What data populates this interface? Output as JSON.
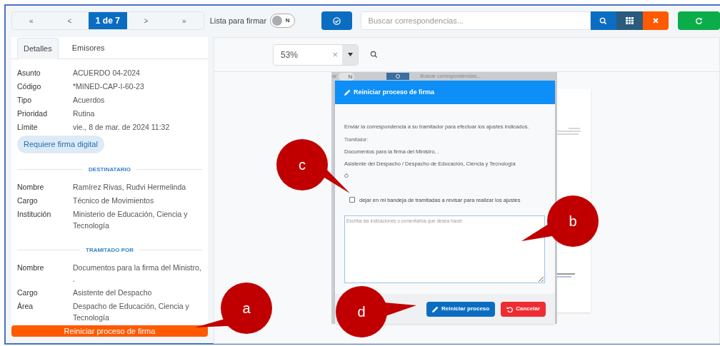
{
  "pager": {
    "items": [
      {
        "label": "«",
        "selected": false
      },
      {
        "label": "<",
        "selected": false
      },
      {
        "label": "1 de 7",
        "selected": true
      },
      {
        "label": ">",
        "selected": false
      },
      {
        "label": "»",
        "selected": false
      }
    ]
  },
  "sign_list_toggle": {
    "label": "Lista para firmar",
    "on": false,
    "state_text": "N"
  },
  "search": {
    "placeholder": "Buscar correspondencias..."
  },
  "details_panel": {
    "tabs": [
      {
        "label": "Detalles",
        "selected": true
      },
      {
        "label": "Emisores",
        "selected": false
      }
    ],
    "fields": [
      {
        "label": "Asunto",
        "value": "ACUERDO 04-2024"
      },
      {
        "label": "Código",
        "value": "*MINED-CAP-I-60-23"
      },
      {
        "label": "Tipo",
        "value": "Acuerdos"
      },
      {
        "label": "Prioridad",
        "value": "Rutina"
      },
      {
        "label": "Límite",
        "value": "vie., 8 de mar. de 2024 11:32"
      }
    ],
    "badge": "Requiere firma digital",
    "sections": [
      {
        "title": "DESTINATARIO",
        "fields": [
          {
            "label": "Nombre",
            "value": "Ramírez Rivas, Rudvi Hermelinda"
          },
          {
            "label": "Cargo",
            "value": "Técnico de Movimientos"
          },
          {
            "label": "Institución",
            "value": "Ministerio de Educación, Ciencia y Tecnología"
          }
        ]
      },
      {
        "title": "TRAMITADO POR",
        "fields": [
          {
            "label": "Nombre",
            "value": "Documentos para la firma del Ministro, ."
          },
          {
            "label": "Cargo",
            "value": "Asistente del Despacho"
          },
          {
            "label": "Área",
            "value": "Despacho de Educación, Ciencia y Tecnología"
          }
        ]
      }
    ],
    "action_button": "Reiniciar proceso de firma"
  },
  "viewer": {
    "zoom": {
      "value": "53%",
      "clear": "×"
    },
    "background_strip": {
      "text_left": "ar",
      "toggle_text": "N",
      "search_placeholder": "Buscar correspondencias..."
    }
  },
  "dialog": {
    "title": "Reiniciar proceso de firma",
    "intro": "Enviar la correspondencia a su tramitador para efectuar los ajustes indicados.",
    "field_label": "Tramitador:",
    "lines": [
      "Documentos para la firma del Ministro, .",
      "Asistente del Despacho / Despacho de Educación, Ciencia y Tecnología",
      "Ó"
    ],
    "checkbox": {
      "label": "dejar en mi bandeja de tramitadas a revisar para realizar los ajustes",
      "checked": false
    },
    "comment": {
      "placeholder": "Escriba las indicaciones o comentarios que desea hacer"
    },
    "buttons": [
      {
        "label": "Reiniciar proceso",
        "kind": "primary"
      },
      {
        "label": "Cancelar",
        "kind": "danger"
      }
    ]
  },
  "callouts": [
    {
      "label": "a"
    },
    {
      "label": "b"
    },
    {
      "label": "c"
    },
    {
      "label": "d"
    }
  ]
}
